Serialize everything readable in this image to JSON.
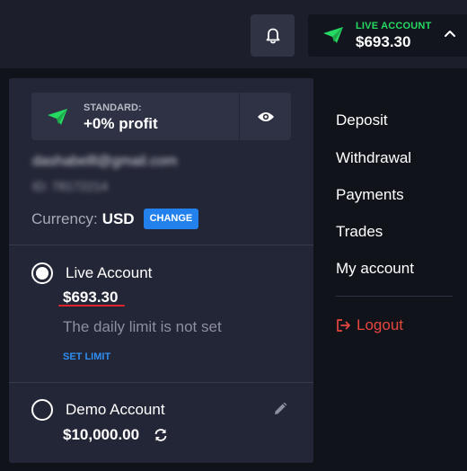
{
  "header": {
    "account_label": "LIVE ACCOUNT",
    "account_balance": "$693.30"
  },
  "profile": {
    "plan_tier": "STANDARD:",
    "plan_profit": "+0% profit",
    "email": "dashabelll@gmail.com",
    "user_id": "ID: 78172214",
    "currency_label": "Currency:",
    "currency_value": "USD",
    "change_label": "CHANGE"
  },
  "accounts": {
    "live": {
      "name": "Live Account",
      "balance": "$693.30",
      "limit_text": "The daily limit is not set",
      "set_limit_label": "SET LIMIT",
      "selected": true
    },
    "demo": {
      "name": "Demo Account",
      "balance": "$10,000.00",
      "selected": false
    }
  },
  "menu": {
    "items": [
      "Deposit",
      "Withdrawal",
      "Payments",
      "Trades",
      "My account"
    ],
    "logout_label": "Logout"
  },
  "colors": {
    "accent_green": "#26d962",
    "link_blue": "#2f8ef2",
    "logout_red": "#e5473f"
  }
}
